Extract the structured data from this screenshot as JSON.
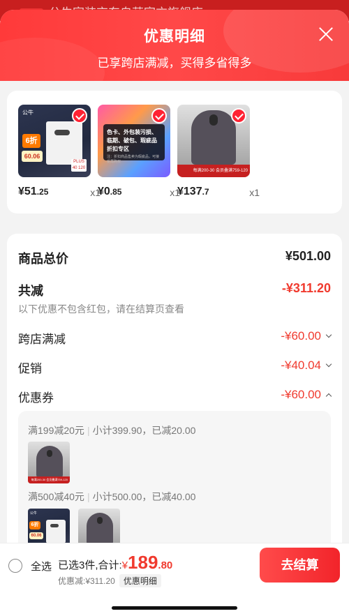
{
  "background_store": {
    "badge": "自营",
    "title": "公牛家装京东自营官方旗舰店 ›"
  },
  "header": {
    "title": "优惠明细",
    "subtitle": "已享跨店满减，买得多省得多"
  },
  "products": [
    {
      "price_int": "¥51",
      "price_dec": ".25",
      "qty": "x1",
      "tag": "6折",
      "tag2": "60.06",
      "logo": "公牛",
      "mini": "PLUS 40 120"
    },
    {
      "price_int": "¥0",
      "price_dec": ".85",
      "qty": "x1",
      "card_text": "色卡、外包装污损、临期、破包、瑕疵品折扣专区",
      "card_small": "注：折扣商品售卖为瑕疵品，可接受再购买"
    },
    {
      "price_int": "¥137",
      "price_dec": ".7",
      "qty": "x1",
      "banner": "每满200-30 会员叠满759-120"
    }
  ],
  "summary": {
    "total_label": "商品总价",
    "total_value": "¥501.00",
    "reduce_label": "共减",
    "reduce_value": "-¥311.20",
    "note": "以下优惠不包含红包，请在结算页查看",
    "cross_label": "跨店满减",
    "cross_value": "-¥60.00",
    "promo_label": "促销",
    "promo_value": "-¥40.04",
    "coupon_label": "优惠券",
    "coupon_value": "-¥60.00"
  },
  "coupons": [
    {
      "rule": "满199减20元",
      "detail": "小计399.90，已减20.00"
    },
    {
      "rule": "满500减40元",
      "detail": "小计500.00，已减40.00"
    }
  ],
  "bottom": {
    "select_all": "全选",
    "selected": "已选3件,合计:",
    "currency": "¥",
    "amount_int": "189",
    "amount_dec": ".80",
    "discount": "优惠减:¥311.20",
    "detail_pill": "优惠明细",
    "checkout": "去结算"
  }
}
